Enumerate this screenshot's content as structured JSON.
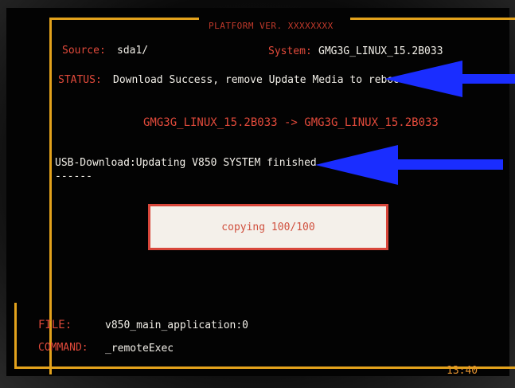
{
  "header": {
    "title": "PLATFORM VER. XXXXXXXX"
  },
  "info": {
    "source_label": "Source:",
    "source_value": "sda1/",
    "system_label": "System:",
    "system_value": "GMG3G_LINUX_15.2B033",
    "status_label": "STATUS:",
    "status_value": "Download Success, remove Update Media to reboot",
    "version_change": "GMG3G_LINUX_15.2B033 -> GMG3G_LINUX_15.2B033"
  },
  "log": {
    "usb_message": "USB-Download:Updating V850 SYSTEM finished",
    "separator": "------"
  },
  "progress": {
    "text": "copying 100/100",
    "value": 1.0
  },
  "footer": {
    "file_label": "FILE:",
    "file_value": "v850_main_application:0",
    "command_label": "COMMAND:",
    "command_value": "_remoteExec",
    "clock": "13:40"
  },
  "colors": {
    "frame": "#e3a21c",
    "label_red": "#e24a3b",
    "text_white": "#f2efe8",
    "arrow_blue": "#1a2dff"
  },
  "icons": {
    "status_arrow": "arrow-left-icon",
    "usb_arrow": "arrow-left-icon"
  }
}
